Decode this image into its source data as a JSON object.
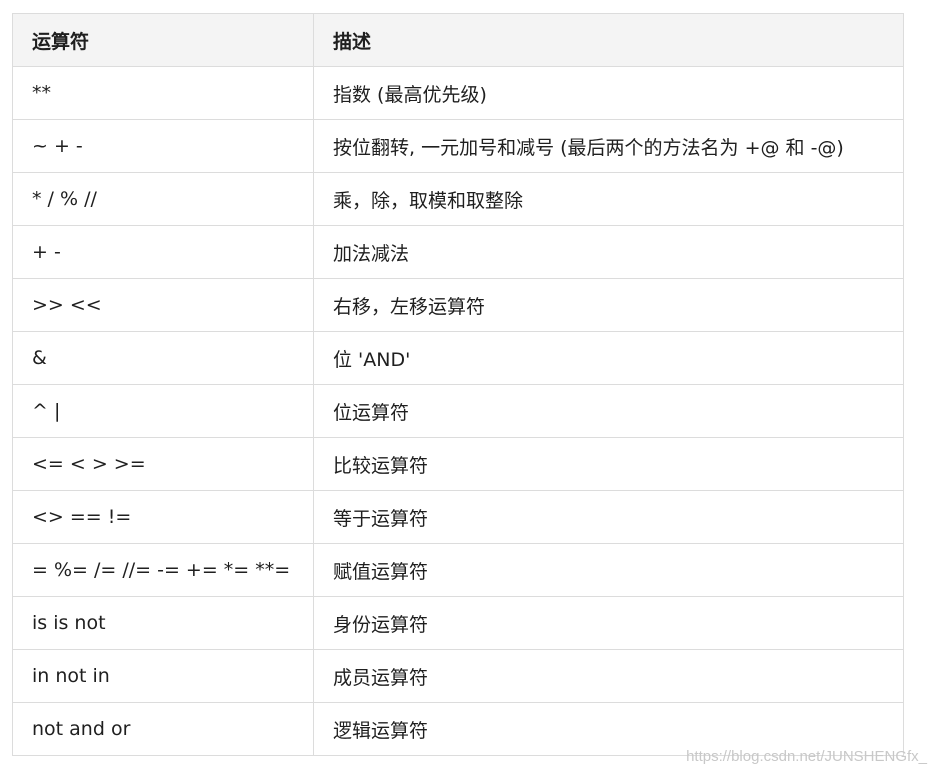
{
  "table": {
    "headers": [
      "运算符",
      "描述"
    ],
    "rows": [
      {
        "operator": "**",
        "description": "指数 (最高优先级)"
      },
      {
        "operator": "~ + -",
        "description": "按位翻转, 一元加号和减号 (最后两个的方法名为 +@ 和 -@)"
      },
      {
        "operator": "* / % //",
        "description": "乘，除，取模和取整除"
      },
      {
        "operator": "+ -",
        "description": "加法减法"
      },
      {
        "operator": ">> <<",
        "description": "右移，左移运算符"
      },
      {
        "operator": "&",
        "description": "位 'AND'"
      },
      {
        "operator": "^ |",
        "description": "位运算符"
      },
      {
        "operator": "<= < > >=",
        "description": "比较运算符"
      },
      {
        "operator": "<> == !=",
        "description": "等于运算符"
      },
      {
        "operator": "= %= /= //= -= += *= **=",
        "description": "赋值运算符"
      },
      {
        "operator": "is is not",
        "description": "身份运算符"
      },
      {
        "operator": "in not in",
        "description": "成员运算符"
      },
      {
        "operator": "not and or",
        "description": "逻辑运算符"
      }
    ]
  },
  "watermark": "https://blog.csdn.net/JUNSHENGfx_"
}
